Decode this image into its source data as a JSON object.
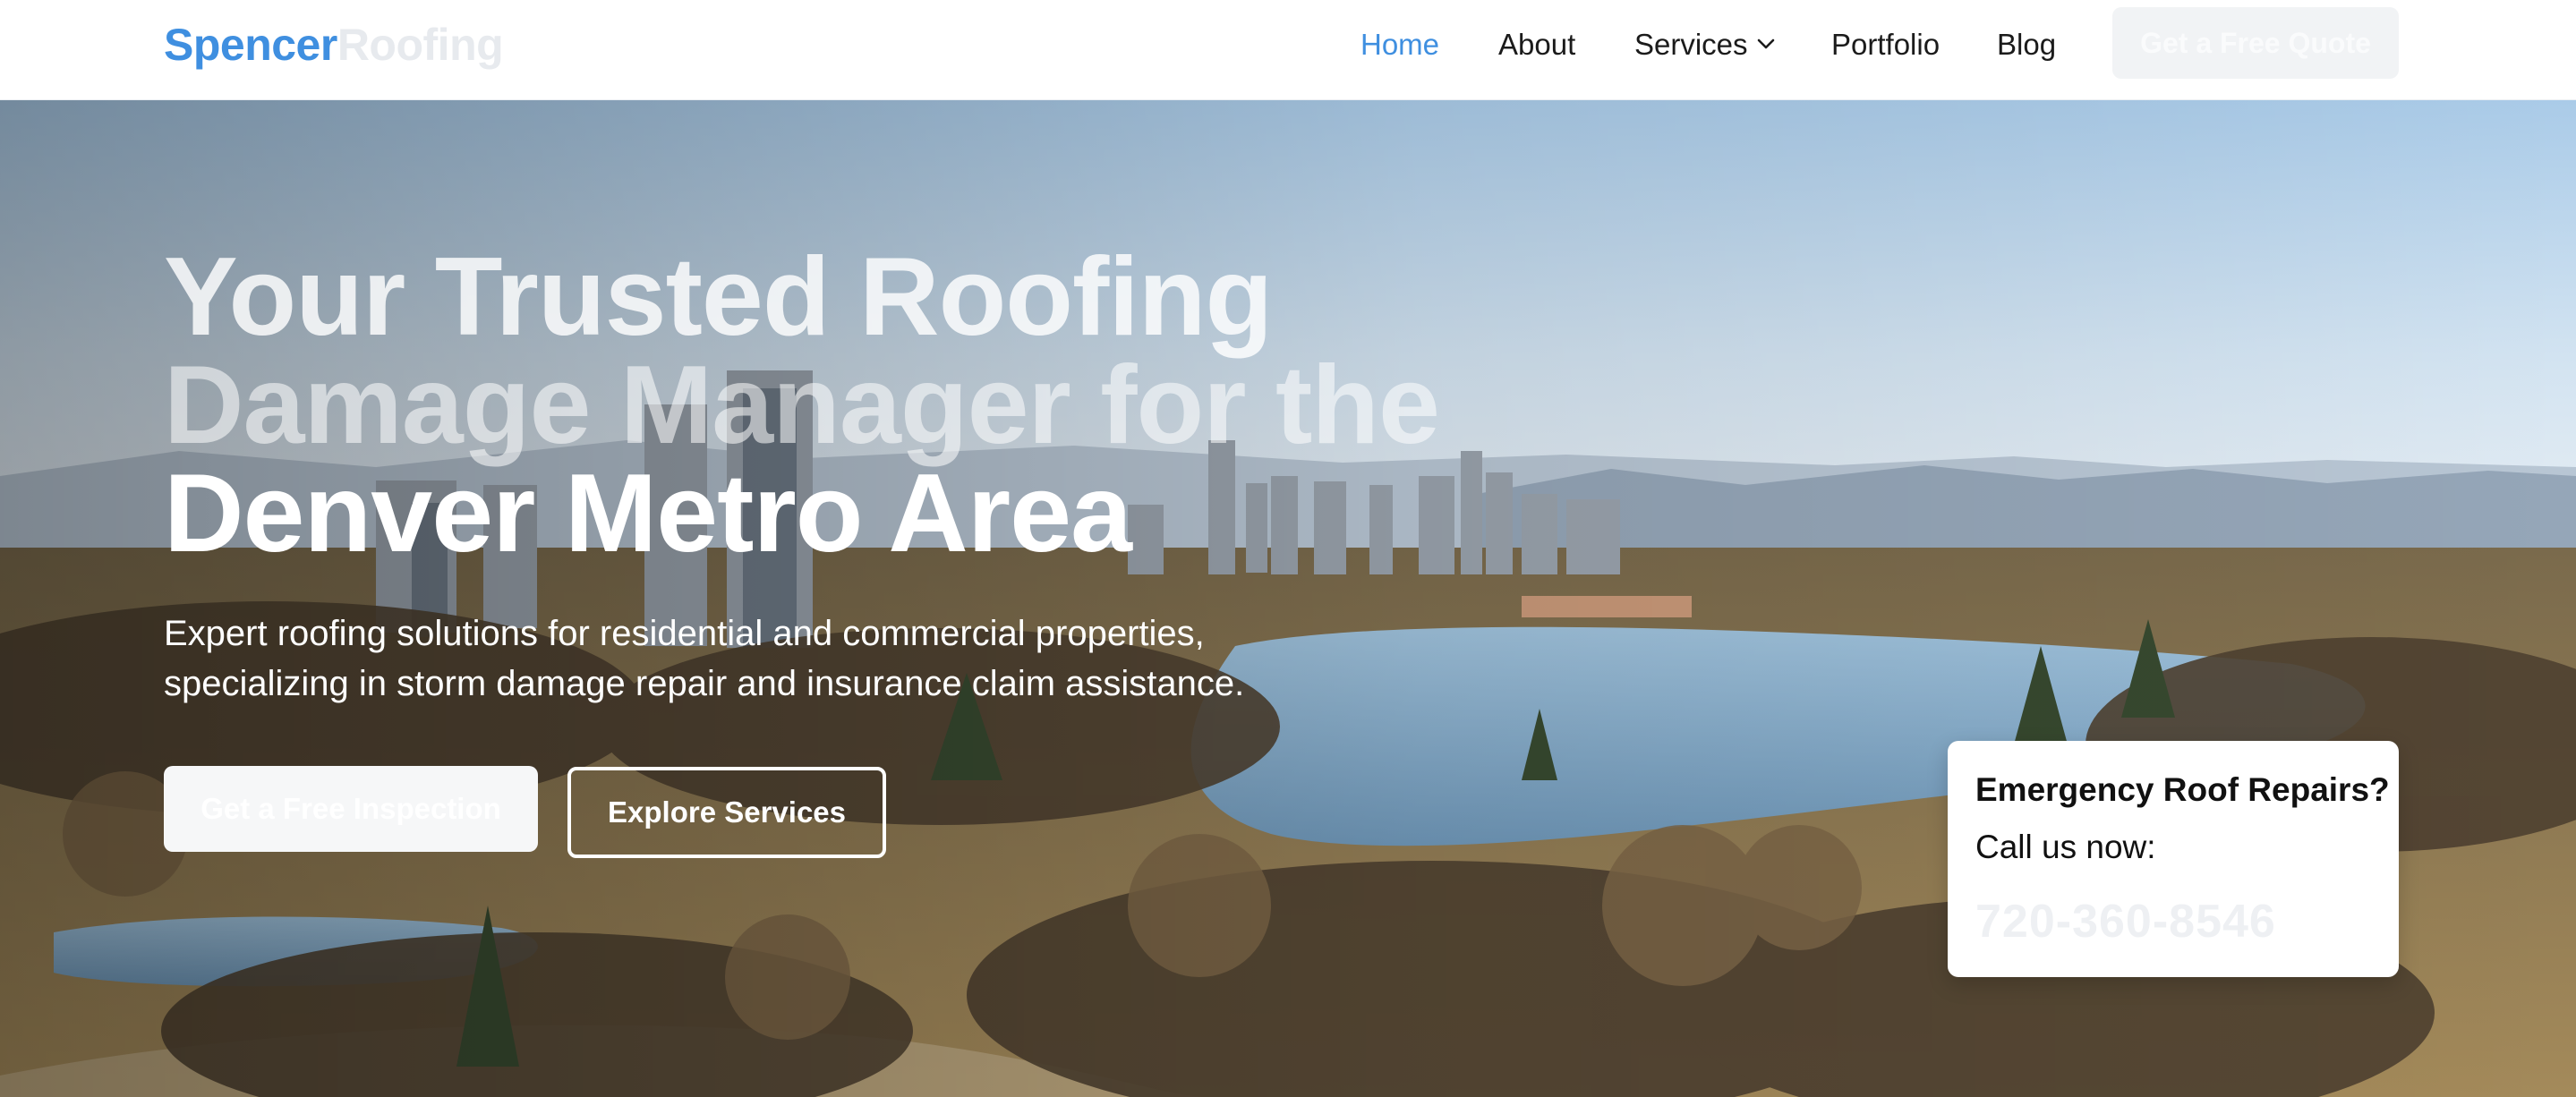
{
  "brand": {
    "name_part1": "Spencer",
    "name_part2": "Roofing",
    "accent": "#3f8fe0"
  },
  "nav": {
    "items": [
      {
        "label": "Home",
        "active": true
      },
      {
        "label": "About"
      },
      {
        "label": "Services",
        "has_dropdown": true
      },
      {
        "label": "Portfolio"
      },
      {
        "label": "Blog"
      }
    ],
    "cta_label": "Get a Free Quote"
  },
  "hero": {
    "headline_lines": [
      "Your Trusted Roofing",
      "Damage Manager for the",
      "Denver Metro Area"
    ],
    "subheadline_lines": [
      "Expert roofing solutions for residential and commercial properties,",
      "specializing in storm damage repair and insurance claim assistance."
    ],
    "primary_button": "Get a Free Inspection",
    "secondary_button": "Explore Services"
  },
  "emergency": {
    "title": "Emergency Roof Repairs?",
    "subtitle": "Call us now:",
    "phone": "720-360-8546"
  }
}
